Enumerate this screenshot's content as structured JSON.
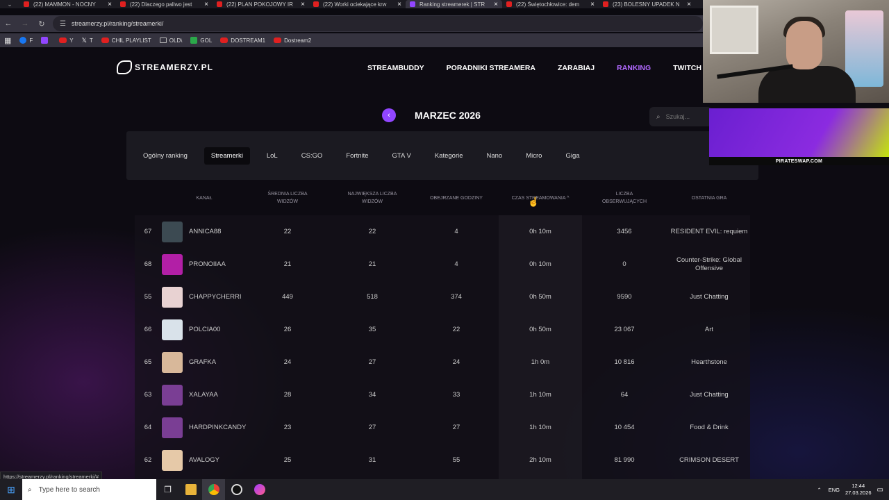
{
  "browser": {
    "tabs": [
      {
        "title": "(22) MAMMON - NOCNY",
        "fav": "youtube"
      },
      {
        "title": "(22) Dlaczego paliwo jest",
        "fav": "youtube"
      },
      {
        "title": "(22) PLAN POKOJOWY IR",
        "fav": "youtube"
      },
      {
        "title": "(22) Worki ociekające krw",
        "fav": "youtube"
      },
      {
        "title": "Ranking streamerek | STR",
        "fav": "streamerzy",
        "active": true
      },
      {
        "title": "(22) Świętochłowice: dem",
        "fav": "youtube"
      },
      {
        "title": "(23) BOLESNY UPADEK N",
        "fav": "youtube"
      }
    ],
    "url": "streamerzy.pl/ranking/streamerki/",
    "bookmarks": [
      {
        "label": "F",
        "icon": "facebook-icon"
      },
      {
        "label": "",
        "icon": "twitch-icon"
      },
      {
        "label": "Y",
        "icon": "youtube-icon"
      },
      {
        "label": "T",
        "icon": "x-icon"
      },
      {
        "label": "CHIL PLAYLIST",
        "icon": "youtube-icon"
      },
      {
        "label": "OLD\\",
        "icon": "folder-icon"
      },
      {
        "label": "GOL",
        "icon": "gol-icon"
      },
      {
        "label": "DOSTREAM1",
        "icon": "youtube-icon"
      },
      {
        "label": "Dostream2",
        "icon": "youtube-icon"
      }
    ],
    "status_url": "https://streamerzy.pl/ranking/streamerki/#"
  },
  "site": {
    "logo": "STREAMERZY.PL",
    "nav": [
      "STREAMBUDDY",
      "PORADNIKI STREAMERA",
      "ZARABIAJ",
      "RANKING",
      "TWITCH TEAM"
    ],
    "active_nav": "RANKING",
    "month": "MARZEC 2026",
    "search_placeholder": "Szukaj...",
    "categories": [
      "Ogólny ranking",
      "Streamerki",
      "LoL",
      "CS:GO",
      "Fortnite",
      "GTA V",
      "Kategorie",
      "Nano",
      "Micro",
      "Giga"
    ],
    "active_category": "Streamerki"
  },
  "table": {
    "headers": {
      "channel": "KANAŁ",
      "avg_viewers": "ŚREDNIA LICZBA\nWIDZÓW",
      "max_viewers": "NAJWIĘKSZA LICZBA\nWIDZÓW",
      "hours_watched": "OBEJRZANE GODZINY",
      "stream_time": "CZAS STREAMOWANIA ^",
      "followers": "LICZBA\nOBSERWUJĄCYCH",
      "last_game": "OSTATNIA GRA"
    },
    "rows": [
      {
        "rank": "67",
        "name": "ANNICA88",
        "avg": "22",
        "max": "22",
        "hours": "4",
        "time": "0h 10m",
        "followers": "3456",
        "game": "RESIDENT EVIL: requiem",
        "avatar": "#3c4a52"
      },
      {
        "rank": "68",
        "name": "PRONOIIAA",
        "avg": "21",
        "max": "21",
        "hours": "4",
        "time": "0h 10m",
        "followers": "0",
        "game": "Counter-Strike: Global Offensive",
        "avatar": "#b21fa6"
      },
      {
        "rank": "55",
        "name": "CHAPPYCHERRI",
        "avg": "449",
        "max": "518",
        "hours": "374",
        "time": "0h 50m",
        "followers": "9590",
        "game": "Just Chatting",
        "avatar": "#e8d2d2"
      },
      {
        "rank": "66",
        "name": "POLCIA00",
        "avg": "26",
        "max": "35",
        "hours": "22",
        "time": "0h 50m",
        "followers": "23 067",
        "game": "Art",
        "avatar": "#d9e2ea"
      },
      {
        "rank": "65",
        "name": "GRAFKA",
        "avg": "24",
        "max": "27",
        "hours": "24",
        "time": "1h 0m",
        "followers": "10 816",
        "game": "Hearthstone",
        "avatar": "#d8b89a"
      },
      {
        "rank": "63",
        "name": "XALAYAA",
        "avg": "28",
        "max": "34",
        "hours": "33",
        "time": "1h 10m",
        "followers": "64",
        "game": "Just Chatting",
        "avatar": "#7a3e94"
      },
      {
        "rank": "64",
        "name": "HARDPINKCANDY",
        "avg": "23",
        "max": "27",
        "hours": "27",
        "time": "1h 10m",
        "followers": "10 454",
        "game": "Food & Drink",
        "avatar": "#7a3e94"
      },
      {
        "rank": "62",
        "name": "AVALOGY",
        "avg": "25",
        "max": "31",
        "hours": "55",
        "time": "2h 10m",
        "followers": "81 990",
        "game": "CRIMSON DESERT",
        "avatar": "#e6c9a8"
      }
    ]
  },
  "overlay": {
    "ad_text": "PIRATESWAP.COM"
  },
  "taskbar": {
    "search_placeholder": "Type here to search",
    "lang": "ENG",
    "time": "12:44",
    "date": "27.03.2026"
  }
}
